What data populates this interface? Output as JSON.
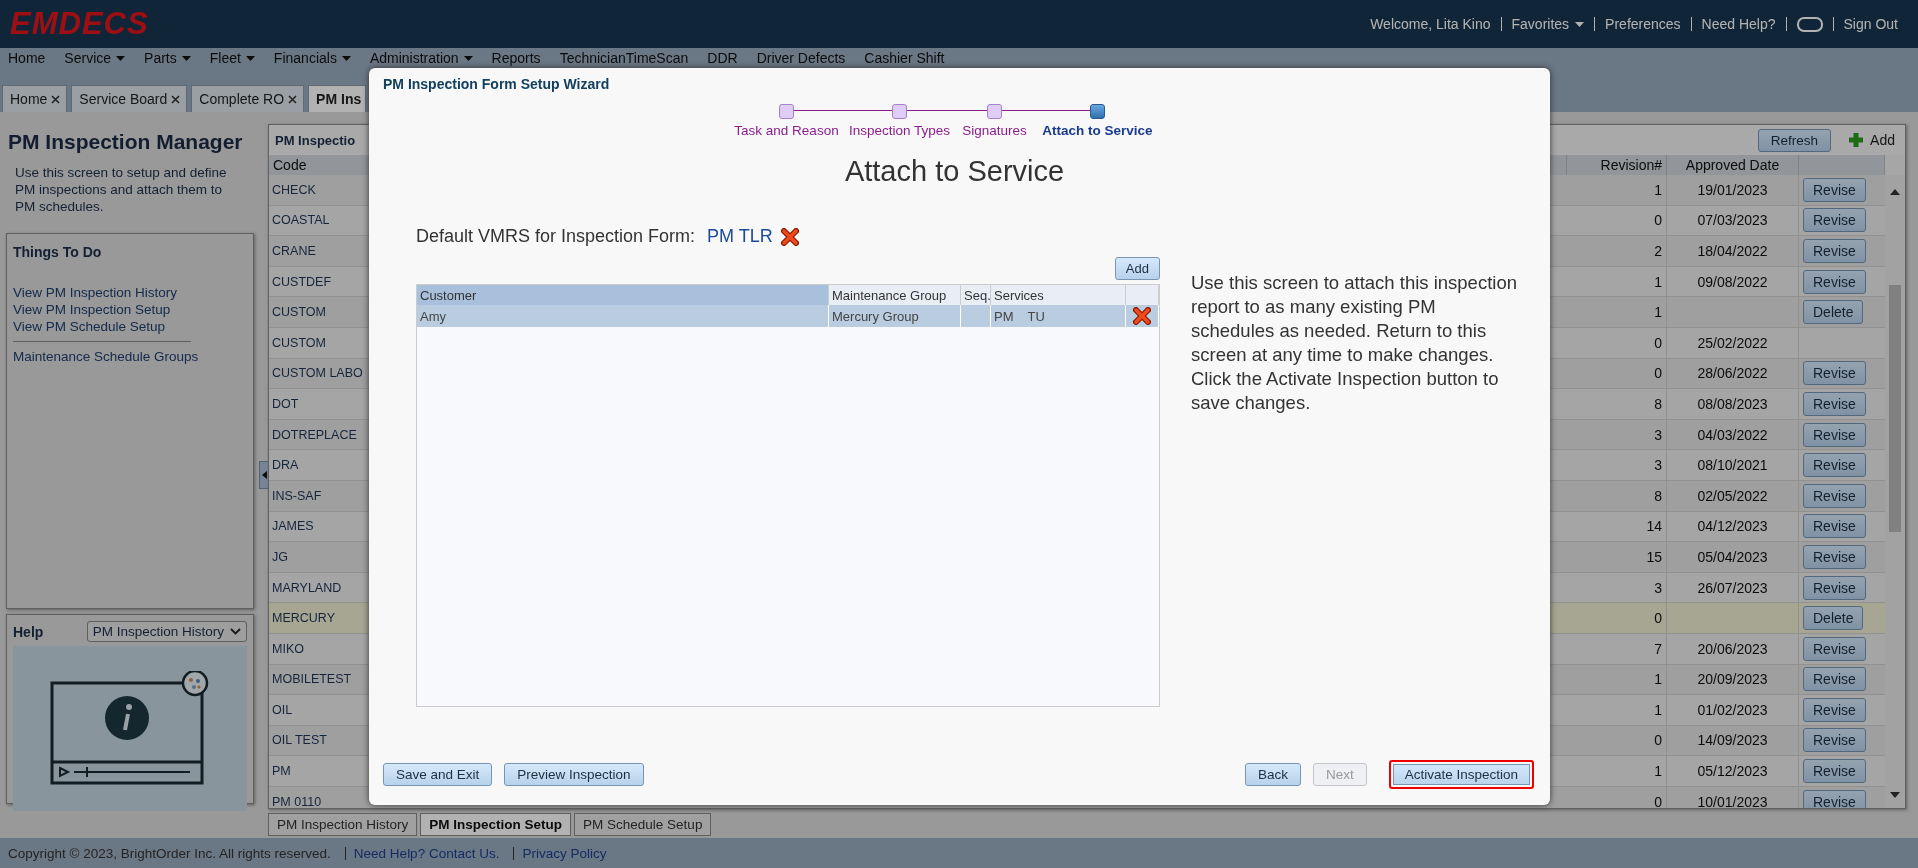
{
  "header": {
    "logo": "EMDECS",
    "welcome": "Welcome, Lita Kino",
    "links": [
      {
        "label": "Favorites",
        "dropdown": true
      },
      {
        "label": "Preferences",
        "dropdown": false
      },
      {
        "label": "Need Help?",
        "dropdown": false
      }
    ],
    "sign_out": "Sign Out"
  },
  "menu": [
    {
      "label": "Home",
      "dropdown": false
    },
    {
      "label": "Service",
      "dropdown": true
    },
    {
      "label": "Parts",
      "dropdown": true
    },
    {
      "label": "Fleet",
      "dropdown": true
    },
    {
      "label": "Financials",
      "dropdown": true
    },
    {
      "label": "Administration",
      "dropdown": true
    },
    {
      "label": "Reports",
      "dropdown": false
    },
    {
      "label": "TechnicianTimeScan",
      "dropdown": false
    },
    {
      "label": "DDR",
      "dropdown": false
    },
    {
      "label": "Driver Defects",
      "dropdown": false
    },
    {
      "label": "Cashier Shift",
      "dropdown": false
    }
  ],
  "tabs": [
    {
      "label": "Home",
      "selected": false,
      "closable": true
    },
    {
      "label": "Service Board",
      "selected": false,
      "closable": true
    },
    {
      "label": "Complete RO",
      "selected": false,
      "closable": true
    },
    {
      "label": "PM Ins",
      "selected": true,
      "closable": false
    }
  ],
  "left_panel": {
    "title": "PM Inspection Manager",
    "description": "Use this screen to setup and define PM inspections and attach them to PM schedules.",
    "things_to_do": {
      "title": "Things To Do",
      "links": [
        "View PM Inspection History",
        "View PM Inspection Setup",
        "View PM Schedule Setup"
      ],
      "more_links": [
        "Maintenance Schedule Groups"
      ]
    },
    "help": {
      "title": "Help",
      "topic": "PM Inspection History"
    }
  },
  "grid": {
    "title": "PM Inspectio",
    "refresh": "Refresh",
    "add": "Add",
    "columns": [
      "Code",
      "Revision#",
      "Approved Date"
    ],
    "rows": [
      {
        "code": "CHECK",
        "revision": "1",
        "date": "19/01/2023",
        "action": "Revise",
        "selected": false
      },
      {
        "code": "COASTAL",
        "revision": "0",
        "date": "07/03/2023",
        "action": "Revise",
        "selected": false
      },
      {
        "code": "CRANE",
        "revision": "2",
        "date": "18/04/2022",
        "action": "Revise",
        "selected": false
      },
      {
        "code": "CUSTDEF",
        "revision": "1",
        "date": "09/08/2022",
        "action": "Revise",
        "selected": false
      },
      {
        "code": "CUSTOM",
        "revision": "1",
        "action": "Delete",
        "selected": false
      },
      {
        "code": "CUSTOM",
        "revision": "0",
        "date": "25/02/2022",
        "selected": false
      },
      {
        "code": "CUSTOM LABO",
        "revision": "0",
        "date": "28/06/2022",
        "action": "Revise",
        "selected": false
      },
      {
        "code": "DOT",
        "revision": "8",
        "date": "08/08/2023",
        "action": "Revise",
        "selected": false
      },
      {
        "code": "DOTREPLACE",
        "revision": "3",
        "date": "04/03/2022",
        "action": "Revise",
        "selected": false
      },
      {
        "code": "DRA",
        "revision": "3",
        "date": "08/10/2021",
        "action": "Revise",
        "selected": false
      },
      {
        "code": "INS-SAF",
        "revision": "8",
        "date": "02/05/2022",
        "action": "Revise",
        "selected": false
      },
      {
        "code": "JAMES",
        "revision": "14",
        "date": "04/12/2023",
        "action": "Revise",
        "selected": false
      },
      {
        "code": "JG",
        "revision": "15",
        "date": "05/04/2023",
        "action": "Revise",
        "selected": false
      },
      {
        "code": "MARYLAND",
        "revision": "3",
        "date": "26/07/2023",
        "action": "Revise",
        "selected": false
      },
      {
        "code": "MERCURY",
        "revision": "0",
        "action": "Delete",
        "selected": true
      },
      {
        "code": "MIKO",
        "revision": "7",
        "date": "20/06/2023",
        "action": "Revise",
        "selected": false
      },
      {
        "code": "MOBILETEST",
        "revision": "1",
        "date": "20/09/2023",
        "action": "Revise",
        "selected": false
      },
      {
        "code": "OIL",
        "revision": "1",
        "date": "01/02/2023",
        "action": "Revise",
        "selected": false
      },
      {
        "code": "OIL TEST",
        "revision": "0",
        "date": "14/09/2023",
        "action": "Revise",
        "selected": false
      },
      {
        "code": "PM",
        "revision": "1",
        "date": "05/12/2023",
        "action": "Revise",
        "selected": false
      },
      {
        "code": "PM 0110",
        "revision": "0",
        "date": "10/01/2023",
        "action": "Revise",
        "selected": false
      }
    ]
  },
  "bottom_tabs": [
    {
      "label": "PM Inspection History",
      "selected": false
    },
    {
      "label": "PM Inspection Setup",
      "selected": true
    },
    {
      "label": "PM Schedule Setup",
      "selected": false
    }
  ],
  "footer": {
    "copyright": "Copyright © 2023, BrightOrder Inc. All rights reserved.",
    "links": [
      "Need Help? Contact Us.",
      "Privacy Policy"
    ]
  },
  "wizard": {
    "title": "PM Inspection Form Setup Wizard",
    "steps": [
      {
        "label": "Task and Reason",
        "selected": false
      },
      {
        "label": "Inspection Types",
        "selected": false
      },
      {
        "label": "Signatures",
        "selected": false
      },
      {
        "label": "Attach to Service",
        "selected": true
      }
    ],
    "heading": "Attach to Service",
    "vmrs_label": "Default VMRS for Inspection Form:",
    "vmrs_value": "PM TLR",
    "add": "Add",
    "table": {
      "columns": [
        "Customer",
        "Maintenance Group",
        "Seq.",
        "Services"
      ],
      "rows": [
        {
          "customer": "Amy",
          "group": "Mercury Group",
          "services": [
            "PM",
            "TU"
          ],
          "selected": true
        }
      ]
    },
    "description": "Use this screen to attach this inspection report to as many existing PM schedules as needed. Return to this screen at any time to make changes. Click the Activate Inspection button to save changes.",
    "buttons_left": [
      "Save and Exit",
      "Preview Inspection"
    ],
    "buttons_right": [
      {
        "label": "Back",
        "disabled": false,
        "highlighted": false
      },
      {
        "label": "Next",
        "disabled": true,
        "highlighted": false
      },
      {
        "label": "Activate Inspection",
        "disabled": false,
        "highlighted": true
      }
    ]
  }
}
